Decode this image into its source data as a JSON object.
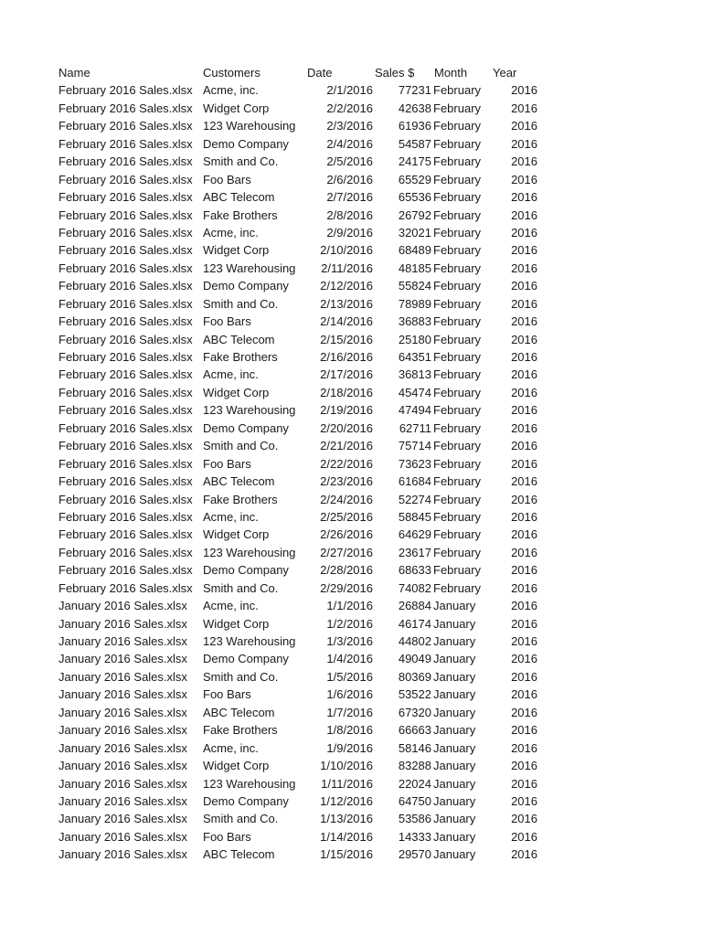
{
  "table": {
    "headers": {
      "name": "Name",
      "customers": "Customers",
      "date": "Date",
      "sales": "Sales $",
      "month": "Month",
      "year": "Year"
    },
    "rows": [
      [
        "February 2016 Sales.xlsx",
        "Acme, inc.",
        "2/1/2016",
        "77231",
        "February",
        "2016"
      ],
      [
        "February 2016 Sales.xlsx",
        "Widget Corp",
        "2/2/2016",
        "42638",
        "February",
        "2016"
      ],
      [
        "February 2016 Sales.xlsx",
        "123 Warehousing",
        "2/3/2016",
        "61936",
        "February",
        "2016"
      ],
      [
        "February 2016 Sales.xlsx",
        "Demo Company",
        "2/4/2016",
        "54587",
        "February",
        "2016"
      ],
      [
        "February 2016 Sales.xlsx",
        "Smith and Co.",
        "2/5/2016",
        "24175",
        "February",
        "2016"
      ],
      [
        "February 2016 Sales.xlsx",
        "Foo Bars",
        "2/6/2016",
        "65529",
        "February",
        "2016"
      ],
      [
        "February 2016 Sales.xlsx",
        "ABC Telecom",
        "2/7/2016",
        "65536",
        "February",
        "2016"
      ],
      [
        "February 2016 Sales.xlsx",
        "Fake Brothers",
        "2/8/2016",
        "26792",
        "February",
        "2016"
      ],
      [
        "February 2016 Sales.xlsx",
        "Acme, inc.",
        "2/9/2016",
        "32021",
        "February",
        "2016"
      ],
      [
        "February 2016 Sales.xlsx",
        "Widget Corp",
        "2/10/2016",
        "68489",
        "February",
        "2016"
      ],
      [
        "February 2016 Sales.xlsx",
        "123 Warehousing",
        "2/11/2016",
        "48185",
        "February",
        "2016"
      ],
      [
        "February 2016 Sales.xlsx",
        "Demo Company",
        "2/12/2016",
        "55824",
        "February",
        "2016"
      ],
      [
        "February 2016 Sales.xlsx",
        "Smith and Co.",
        "2/13/2016",
        "78989",
        "February",
        "2016"
      ],
      [
        "February 2016 Sales.xlsx",
        "Foo Bars",
        "2/14/2016",
        "36883",
        "February",
        "2016"
      ],
      [
        "February 2016 Sales.xlsx",
        "ABC Telecom",
        "2/15/2016",
        "25180",
        "February",
        "2016"
      ],
      [
        "February 2016 Sales.xlsx",
        "Fake Brothers",
        "2/16/2016",
        "64351",
        "February",
        "2016"
      ],
      [
        "February 2016 Sales.xlsx",
        "Acme, inc.",
        "2/17/2016",
        "36813",
        "February",
        "2016"
      ],
      [
        "February 2016 Sales.xlsx",
        "Widget Corp",
        "2/18/2016",
        "45474",
        "February",
        "2016"
      ],
      [
        "February 2016 Sales.xlsx",
        "123 Warehousing",
        "2/19/2016",
        "47494",
        "February",
        "2016"
      ],
      [
        "February 2016 Sales.xlsx",
        "Demo Company",
        "2/20/2016",
        "62711",
        "February",
        "2016"
      ],
      [
        "February 2016 Sales.xlsx",
        "Smith and Co.",
        "2/21/2016",
        "75714",
        "February",
        "2016"
      ],
      [
        "February 2016 Sales.xlsx",
        "Foo Bars",
        "2/22/2016",
        "73623",
        "February",
        "2016"
      ],
      [
        "February 2016 Sales.xlsx",
        "ABC Telecom",
        "2/23/2016",
        "61684",
        "February",
        "2016"
      ],
      [
        "February 2016 Sales.xlsx",
        "Fake Brothers",
        "2/24/2016",
        "52274",
        "February",
        "2016"
      ],
      [
        "February 2016 Sales.xlsx",
        "Acme, inc.",
        "2/25/2016",
        "58845",
        "February",
        "2016"
      ],
      [
        "February 2016 Sales.xlsx",
        "Widget Corp",
        "2/26/2016",
        "64629",
        "February",
        "2016"
      ],
      [
        "February 2016 Sales.xlsx",
        "123 Warehousing",
        "2/27/2016",
        "23617",
        "February",
        "2016"
      ],
      [
        "February 2016 Sales.xlsx",
        "Demo Company",
        "2/28/2016",
        "68633",
        "February",
        "2016"
      ],
      [
        "February 2016 Sales.xlsx",
        "Smith and Co.",
        "2/29/2016",
        "74082",
        "February",
        "2016"
      ],
      [
        "January 2016 Sales.xlsx",
        "Acme, inc.",
        "1/1/2016",
        "26884",
        "January",
        "2016"
      ],
      [
        "January 2016 Sales.xlsx",
        "Widget Corp",
        "1/2/2016",
        "46174",
        "January",
        "2016"
      ],
      [
        "January 2016 Sales.xlsx",
        "123 Warehousing",
        "1/3/2016",
        "44802",
        "January",
        "2016"
      ],
      [
        "January 2016 Sales.xlsx",
        "Demo Company",
        "1/4/2016",
        "49049",
        "January",
        "2016"
      ],
      [
        "January 2016 Sales.xlsx",
        "Smith and Co.",
        "1/5/2016",
        "80369",
        "January",
        "2016"
      ],
      [
        "January 2016 Sales.xlsx",
        "Foo Bars",
        "1/6/2016",
        "53522",
        "January",
        "2016"
      ],
      [
        "January 2016 Sales.xlsx",
        "ABC Telecom",
        "1/7/2016",
        "67320",
        "January",
        "2016"
      ],
      [
        "January 2016 Sales.xlsx",
        "Fake Brothers",
        "1/8/2016",
        "66663",
        "January",
        "2016"
      ],
      [
        "January 2016 Sales.xlsx",
        "Acme, inc.",
        "1/9/2016",
        "58146",
        "January",
        "2016"
      ],
      [
        "January 2016 Sales.xlsx",
        "Widget Corp",
        "1/10/2016",
        "83288",
        "January",
        "2016"
      ],
      [
        "January 2016 Sales.xlsx",
        "123 Warehousing",
        "1/11/2016",
        "22024",
        "January",
        "2016"
      ],
      [
        "January 2016 Sales.xlsx",
        "Demo Company",
        "1/12/2016",
        "64750",
        "January",
        "2016"
      ],
      [
        "January 2016 Sales.xlsx",
        "Smith and Co.",
        "1/13/2016",
        "53586",
        "January",
        "2016"
      ],
      [
        "January 2016 Sales.xlsx",
        "Foo Bars",
        "1/14/2016",
        "14333",
        "January",
        "2016"
      ],
      [
        "January 2016 Sales.xlsx",
        "ABC Telecom",
        "1/15/2016",
        "29570",
        "January",
        "2016"
      ]
    ]
  }
}
